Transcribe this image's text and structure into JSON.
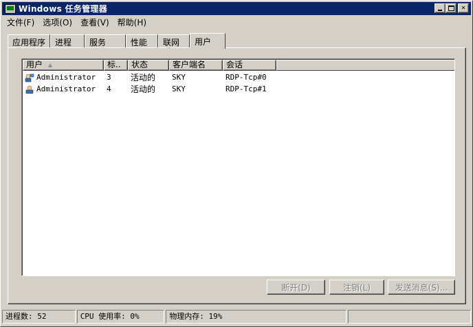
{
  "window": {
    "title": "Windows 任务管理器",
    "buttons": {
      "minimize": "_",
      "maximize": "□",
      "close": "×"
    }
  },
  "menu": [
    {
      "label": "文件(F)"
    },
    {
      "label": "选项(O)"
    },
    {
      "label": "查看(V)"
    },
    {
      "label": "帮助(H)"
    }
  ],
  "tabs": [
    {
      "label": "应用程序",
      "active": false
    },
    {
      "label": "进程",
      "active": false
    },
    {
      "label": "服务",
      "active": false
    },
    {
      "label": "性能",
      "active": false
    },
    {
      "label": "联网",
      "active": false
    },
    {
      "label": "用户",
      "active": true
    }
  ],
  "users_table": {
    "columns": [
      "用户",
      "标..",
      "状态",
      "客户端名",
      "会话"
    ],
    "sort_column": "用户",
    "rows": [
      {
        "user": "Administrator",
        "id": "3",
        "status": "活动的",
        "client": "SKY",
        "session": "RDP-Tcp#0",
        "icon": "user-icon"
      },
      {
        "user": "Administrator",
        "id": "4",
        "status": "活动的",
        "client": "SKY",
        "session": "RDP-Tcp#1",
        "icon": "user-icon"
      }
    ]
  },
  "buttons": {
    "disconnect": "断开(D)",
    "logoff": "注销(L)",
    "send_message": "发送消息(S)..."
  },
  "status": {
    "processes": "进程数: 52",
    "cpu": "CPU 使用率: 0%",
    "memory": "物理内存: 19%"
  }
}
